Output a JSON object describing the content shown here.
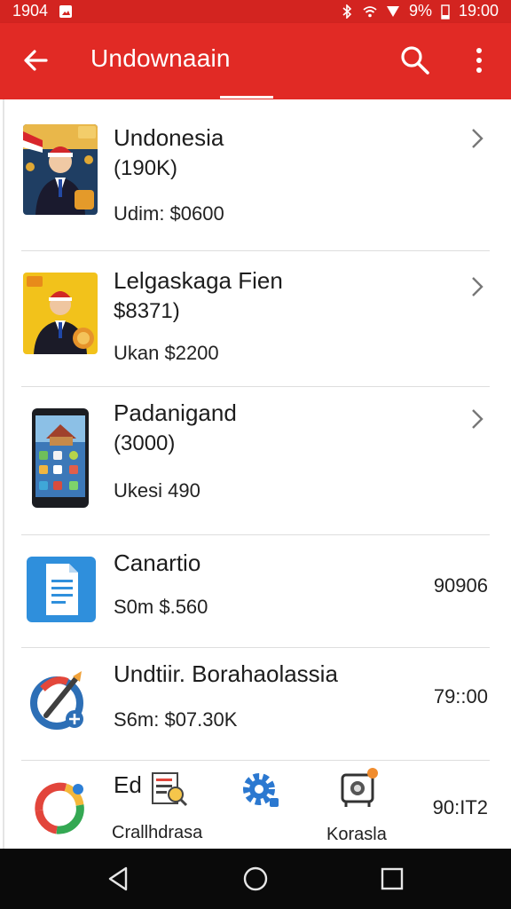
{
  "status_bar": {
    "left_time": "1904",
    "battery": "9%",
    "time": "19:00",
    "icons": [
      "photo-icon",
      "bluetooth-icon",
      "wifi-icon",
      "signal-icon",
      "battery-icon"
    ]
  },
  "app_bar": {
    "title": "Undownaain",
    "icons": [
      "arrow-left-icon",
      "search-icon",
      "more-vert-icon"
    ]
  },
  "list": [
    {
      "title": "Undonesia",
      "subtitle": "(190K)",
      "price": "Udim: $0600",
      "thumb": "portrait-red-hat",
      "chevron": true
    },
    {
      "title": "Lelgaskaga Fien",
      "subtitle": "$8371)",
      "price": "Ukan $2200",
      "thumb": "portrait-yellow",
      "chevron": true
    },
    {
      "title": "Padanigand",
      "subtitle": "(3000)",
      "price": "Ukesi 490",
      "thumb": "phone-app",
      "chevron": true
    },
    {
      "title": "Canartio",
      "price": "S0m $.560",
      "value": "90906",
      "thumb": "document-app",
      "chevron": false
    },
    {
      "title": "Undtiir. Borahaolassia",
      "price": "S6m: $07.30K",
      "value": "79::00",
      "thumb": "brush-app",
      "chevron": false
    },
    {
      "title": "Ed",
      "price": "Crallhdrasa",
      "mid_label": "Korasla",
      "value": "90:IT2",
      "thumb": "sync-app",
      "chevron": false
    }
  ],
  "colors": {
    "primary": "#e12a25",
    "status": "#d32420",
    "nav": "#0a0a0a"
  },
  "nav_bar": {
    "icons": [
      "back-triangle-icon",
      "home-circle-icon",
      "recents-square-icon"
    ]
  }
}
